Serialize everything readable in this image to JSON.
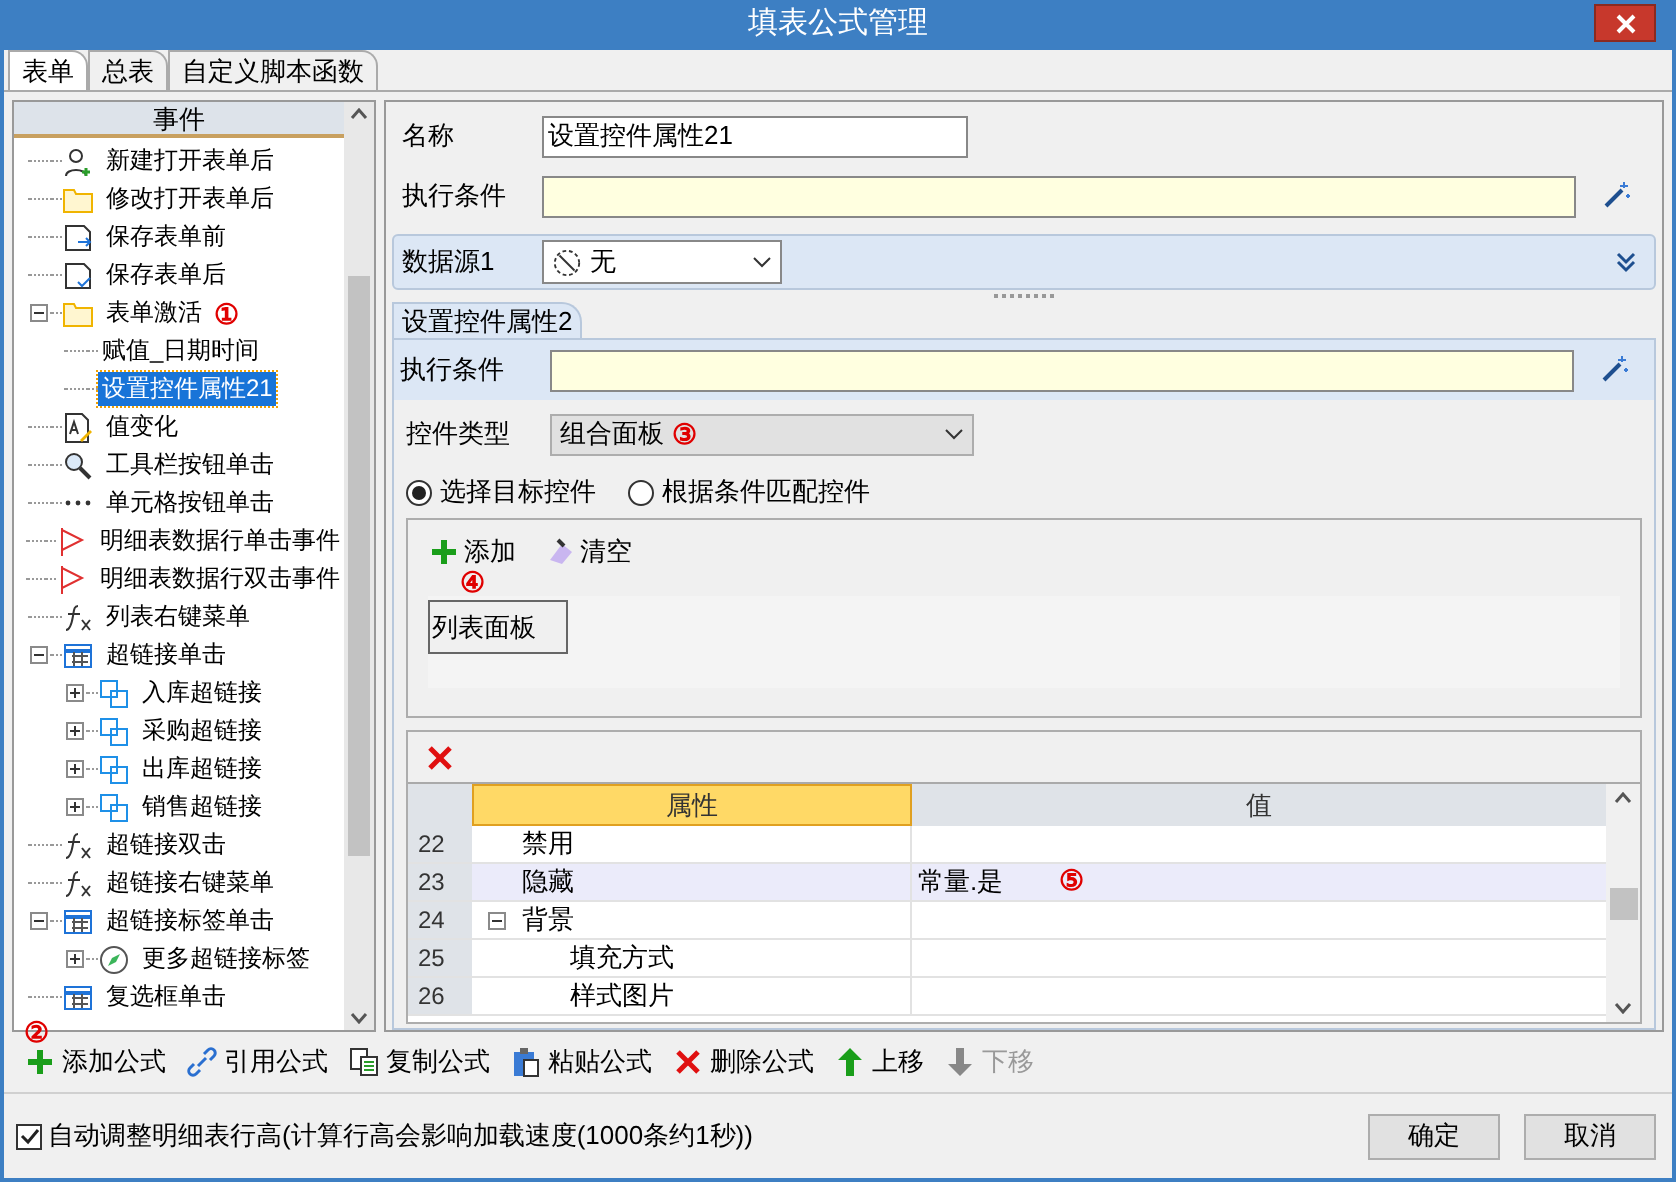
{
  "window": {
    "title": "填表公式管理"
  },
  "tabs": [
    {
      "label": "表单",
      "selected": true
    },
    {
      "label": "总表",
      "selected": false
    },
    {
      "label": "自定义脚本函数",
      "selected": false
    }
  ],
  "events": {
    "header": "事件",
    "items": [
      {
        "kind": "person",
        "label": "新建打开表单后",
        "selected": false
      },
      {
        "kind": "folder",
        "label": "修改打开表单后",
        "selected": false
      },
      {
        "kind": "save-arrow",
        "label": "保存表单前",
        "selected": false
      },
      {
        "kind": "save-check",
        "label": "保存表单后",
        "selected": false
      },
      {
        "kind": "folder",
        "label": "表单激活",
        "selected": false,
        "annotation": "①",
        "expanded": true,
        "children": [
          {
            "kind": "plain",
            "label": "赋值_日期时间",
            "selected": false
          },
          {
            "kind": "plain",
            "label": "设置控件属性21",
            "selected": true
          }
        ]
      },
      {
        "kind": "edit",
        "label": "值变化",
        "selected": false
      },
      {
        "kind": "magnifier",
        "label": "工具栏按钮单击",
        "selected": false
      },
      {
        "kind": "dots",
        "label": "单元格按钮单击",
        "selected": false
      },
      {
        "kind": "flag",
        "label": "明细表数据行单击事件",
        "selected": false
      },
      {
        "kind": "flag",
        "label": "明细表数据行双击事件",
        "selected": false
      },
      {
        "kind": "fx",
        "label": "列表右键菜单",
        "selected": false
      },
      {
        "kind": "grid",
        "label": "超链接单击",
        "selected": false,
        "expanded": true,
        "children": [
          {
            "kind": "link",
            "label": "入库超链接",
            "selected": false,
            "expanded": false
          },
          {
            "kind": "link",
            "label": "采购超链接",
            "selected": false,
            "expanded": false
          },
          {
            "kind": "link",
            "label": "出库超链接",
            "selected": false,
            "expanded": false
          },
          {
            "kind": "link",
            "label": "销售超链接",
            "selected": false,
            "expanded": false
          }
        ]
      },
      {
        "kind": "fx",
        "label": "超链接双击",
        "selected": false
      },
      {
        "kind": "fx",
        "label": "超链接右键菜单",
        "selected": false
      },
      {
        "kind": "grid",
        "label": "超链接标签单击",
        "selected": false,
        "expanded": true,
        "children": [
          {
            "kind": "compass",
            "label": "更多超链接标签",
            "selected": false,
            "expanded": false
          }
        ]
      },
      {
        "kind": "grid",
        "label": "复选框单击",
        "selected": false
      }
    ]
  },
  "form": {
    "name_label": "名称",
    "name_value": "设置控件属性21",
    "condition_label": "执行条件",
    "datasource_label": "数据源1",
    "datasource_value": "无"
  },
  "action": {
    "tab": "设置控件属性2",
    "condition_label": "执行条件",
    "type_label": "控件类型",
    "type_value": "组合面板",
    "type_annotation": "③",
    "radios": [
      {
        "label": "选择目标控件",
        "selected": true
      },
      {
        "label": "根据条件匹配控件",
        "selected": false
      }
    ],
    "add_label": "添加",
    "add_annotation": "④",
    "clear_label": "清空",
    "targets": [
      "列表面板"
    ]
  },
  "properties": {
    "columns": [
      "属性",
      "值"
    ],
    "rows": [
      {
        "num": "22",
        "name": "禁用",
        "selected": false
      },
      {
        "num": "23",
        "name": "隐藏",
        "value": "常量.是",
        "selected": true,
        "annotation": "⑤"
      },
      {
        "num": "24",
        "name": "背景",
        "selected": false,
        "expanded": true,
        "children": [
          {
            "num": "25",
            "name": "填充方式",
            "selected": false
          },
          {
            "num": "26",
            "name": "样式图片",
            "selected": false
          }
        ]
      }
    ]
  },
  "toolbar": {
    "annotation": "②",
    "buttons": [
      {
        "kind": "add",
        "label": "添加公式",
        "disabled": false
      },
      {
        "kind": "link",
        "label": "引用公式",
        "disabled": false
      },
      {
        "kind": "copy",
        "label": "复制公式",
        "disabled": false
      },
      {
        "kind": "paste",
        "label": "粘贴公式",
        "disabled": false
      },
      {
        "kind": "delete",
        "label": "删除公式",
        "disabled": false
      },
      {
        "kind": "up",
        "label": "上移",
        "disabled": false
      },
      {
        "kind": "down",
        "label": "下移",
        "disabled": true
      }
    ]
  },
  "footer": {
    "checkbox": {
      "label": "自动调整明细表行高(计算行高会影响加载速度(1000条约1秒))",
      "checked": true
    },
    "buttons": [
      "确定",
      "取消"
    ]
  }
}
